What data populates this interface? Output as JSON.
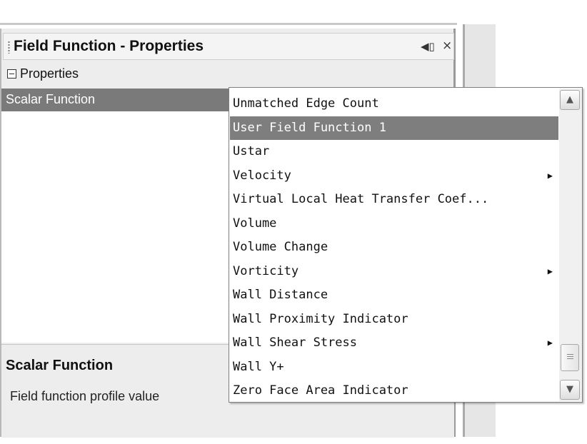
{
  "panel": {
    "title": "Field Function - Properties",
    "section_label": "Properties",
    "property_key": "Scalar Function"
  },
  "description": {
    "title": "Scalar Function",
    "text": "Field function profile value"
  },
  "dropdown": {
    "items": [
      {
        "label": "Unmatched Edge Count",
        "submenu": false,
        "selected": false
      },
      {
        "label": "User Field Function 1",
        "submenu": false,
        "selected": true
      },
      {
        "label": "Ustar",
        "submenu": false,
        "selected": false
      },
      {
        "label": "Velocity",
        "submenu": true,
        "selected": false
      },
      {
        "label": "Virtual Local Heat Transfer Coef...",
        "submenu": false,
        "selected": false
      },
      {
        "label": "Volume",
        "submenu": false,
        "selected": false
      },
      {
        "label": "Volume Change",
        "submenu": false,
        "selected": false
      },
      {
        "label": "Vorticity",
        "submenu": true,
        "selected": false
      },
      {
        "label": "Wall Distance",
        "submenu": false,
        "selected": false
      },
      {
        "label": "Wall Proximity Indicator",
        "submenu": false,
        "selected": false
      },
      {
        "label": "Wall Shear Stress",
        "submenu": true,
        "selected": false
      },
      {
        "label": "Wall Y+",
        "submenu": false,
        "selected": false
      },
      {
        "label": "Zero Face Area Indicator",
        "submenu": false,
        "selected": false
      }
    ]
  },
  "icons": {
    "pin": "pin-icon",
    "close": "close-icon",
    "collapse": "collapse-icon",
    "submenu": "submenu-arrow-icon",
    "scroll_up": "scroll-up-icon",
    "scroll_down": "scroll-down-icon"
  },
  "colors": {
    "selection": "#7e7e7e",
    "panel_bg": "#ededed",
    "list_bg": "#ffffff"
  }
}
